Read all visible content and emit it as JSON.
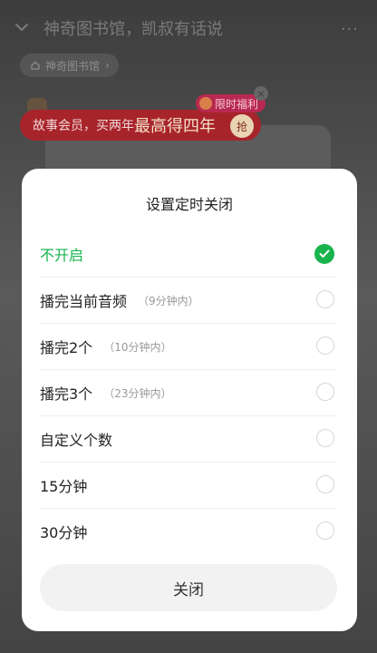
{
  "header": {
    "title": "神奇图书馆，凯叔有话说",
    "more_label": "···",
    "chip_label": "神奇图书馆"
  },
  "promo": {
    "text_prefix": "故事会员，买两年",
    "text_highlight": "最高得四年",
    "grab_label": "抢",
    "badge_label": "限时福利",
    "close_glyph": "×"
  },
  "sheet": {
    "title": "设置定时关闭",
    "options": [
      {
        "label": "不开启",
        "sub": "",
        "selected": true
      },
      {
        "label": "播完当前音频",
        "sub": "（9分钟内）",
        "selected": false
      },
      {
        "label": "播完2个",
        "sub": "（10分钟内）",
        "selected": false
      },
      {
        "label": "播完3个",
        "sub": "（23分钟内）",
        "selected": false
      },
      {
        "label": "自定义个数",
        "sub": "",
        "selected": false
      },
      {
        "label": "15分钟",
        "sub": "",
        "selected": false
      },
      {
        "label": "30分钟",
        "sub": "",
        "selected": false
      }
    ],
    "close_label": "关闭"
  },
  "colors": {
    "accent": "#19b34e",
    "banner": "#a8242b"
  }
}
